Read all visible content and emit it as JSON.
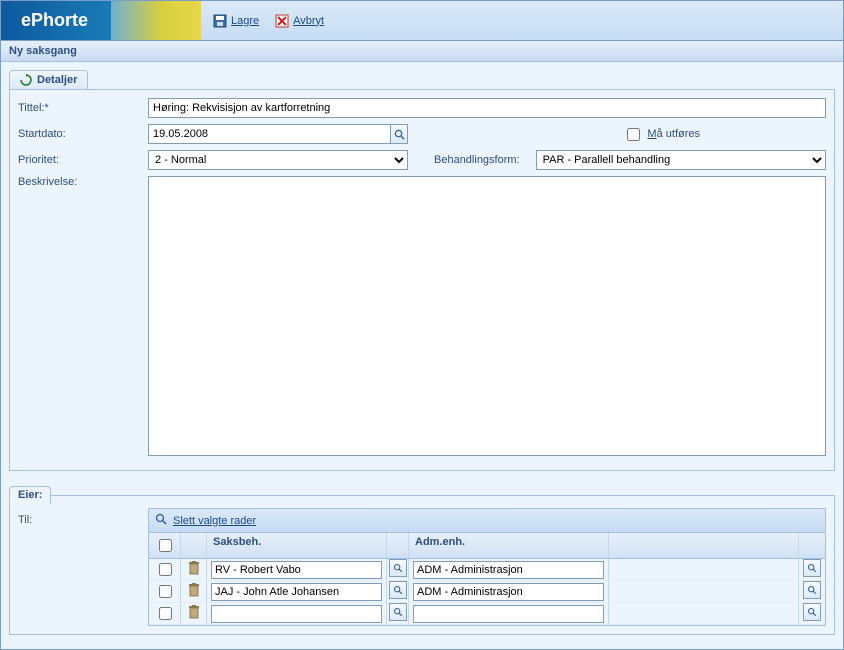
{
  "brand": "ePhorte",
  "toolbar": {
    "save": "Lagre",
    "cancel": "Avbryt"
  },
  "subtitle": "Ny saksgang",
  "section": {
    "title": "Detaljer"
  },
  "form": {
    "tittel_label": "Tittel:*",
    "tittel_value": "Høring: Rekvisisjon av kartforretning",
    "startdato_label": "Startdato:",
    "startdato_value": "19.05.2008",
    "ma_utfores_label": "Må utføres",
    "prioritet_label": "Prioritet:",
    "prioritet_value": "2 - Normal",
    "behandlingsform_label": "Behandlingsform:",
    "behandlingsform_value": "PAR - Parallell behandling",
    "beskrivelse_label": "Beskrivelse:",
    "beskrivelse_value": ""
  },
  "eier": {
    "tab_label": "Eier:",
    "til_label": "Til:",
    "delete_rows_label": "Slett valgte rader",
    "columns": {
      "saksbeh": "Saksbeh.",
      "admenh": "Adm.enh."
    },
    "rows": [
      {
        "saksbeh": "RV - Robert Vabo",
        "admenh": "ADM - Administrasjon"
      },
      {
        "saksbeh": "JAJ - John Atle Johansen",
        "admenh": "ADM - Administrasjon"
      },
      {
        "saksbeh": "",
        "admenh": ""
      }
    ]
  }
}
